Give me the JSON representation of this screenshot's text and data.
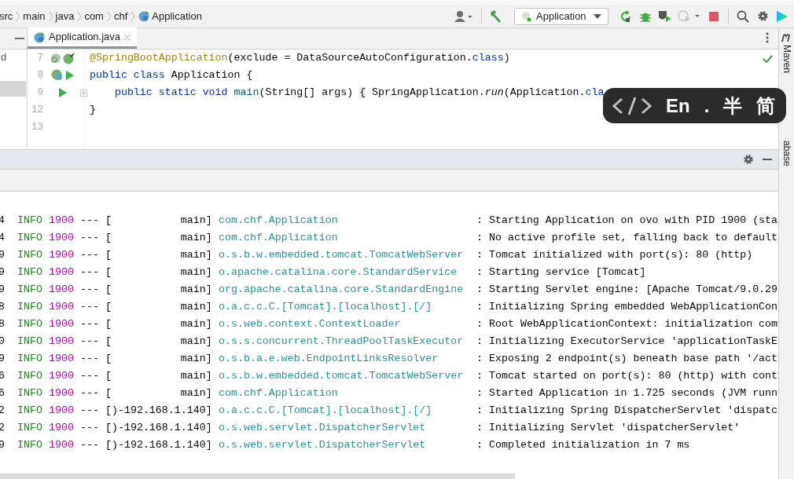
{
  "breadcrumbs": [
    "src",
    "main",
    "java",
    "com",
    "chf",
    "Application"
  ],
  "toolbar": {
    "run_config": "Application"
  },
  "project_panel": {
    "text": "d"
  },
  "editor_tabs": [
    {
      "label": "Application.java",
      "selected": true
    }
  ],
  "editor": {
    "lines": [
      {
        "number": "7",
        "gutter": [
          {
            "kind": "bean-search"
          },
          {
            "kind": "spring-check"
          }
        ],
        "fold": false,
        "tokens": [
          {
            "kind": "annotation",
            "text": "@SpringBootApplication"
          },
          {
            "kind": "plain",
            "text": "(exclude = DataSourceAutoConfiguration."
          },
          {
            "kind": "keyword",
            "text": "class"
          },
          {
            "kind": "plain",
            "text": ")"
          }
        ]
      },
      {
        "number": "8",
        "gutter": [
          {
            "kind": "spring-class"
          },
          {
            "kind": "run"
          }
        ],
        "fold": false,
        "tokens": [
          {
            "kind": "keyword",
            "text": "public class"
          },
          {
            "kind": "plain",
            "text": " Application {"
          }
        ]
      },
      {
        "number": "9",
        "gutter": [
          {
            "kind": "run"
          }
        ],
        "fold": true,
        "tokens": [
          {
            "kind": "keyword",
            "text": "    public static void"
          },
          {
            "kind": "method",
            "text": " main"
          },
          {
            "kind": "plain",
            "text": "(String[] args) "
          },
          {
            "kind": "brace",
            "text": "{"
          },
          {
            "kind": "plain",
            "text": " SpringApplication."
          },
          {
            "kind": "italic",
            "text": "run"
          },
          {
            "kind": "plain",
            "text": "(Application."
          },
          {
            "kind": "keyword",
            "text": "cla"
          }
        ]
      },
      {
        "number": "12",
        "fold": false,
        "tokens": [
          {
            "kind": "plain",
            "text": "}"
          }
        ]
      },
      {
        "number": "13",
        "fold": false
      }
    ]
  },
  "right_sidebar": [
    "Maven",
    "abase"
  ],
  "ime_overlay": {
    "items": [
      "En",
      ".",
      "半",
      "简"
    ]
  },
  "console": {
    "lines": [
      {
        "time_tail": "4",
        "level": "INFO",
        "pid": "1900",
        "separator": "---",
        "thread": "[           main]",
        "logger": "com.chf.Application",
        "colon": ":",
        "message": "Starting Application on ovo with PID 1900 (sta"
      },
      {
        "time_tail": "4",
        "level": "INFO",
        "pid": "1900",
        "separator": "---",
        "thread": "[           main]",
        "logger": "com.chf.Application",
        "colon": ":",
        "message": "No active profile set, falling back to default"
      },
      {
        "time_tail": "9",
        "level": "INFO",
        "pid": "1900",
        "separator": "---",
        "thread": "[           main]",
        "logger": "o.s.b.w.embedded.tomcat.TomcatWebServer",
        "colon": ":",
        "message": "Tomcat initialized with port(s): 80 (http)"
      },
      {
        "time_tail": "9",
        "level": "INFO",
        "pid": "1900",
        "separator": "---",
        "thread": "[           main]",
        "logger": "o.apache.catalina.core.StandardService",
        "colon": ":",
        "message": "Starting service [Tomcat]"
      },
      {
        "time_tail": "9",
        "level": "INFO",
        "pid": "1900",
        "separator": "---",
        "thread": "[           main]",
        "logger": "org.apache.catalina.core.StandardEngine",
        "colon": ":",
        "message": "Starting Servlet engine: [Apache Tomcat/9.0.29"
      },
      {
        "time_tail": "8",
        "level": "INFO",
        "pid": "1900",
        "separator": "---",
        "thread": "[           main]",
        "logger": "o.a.c.c.C.[Tomcat].[localhost].[/]",
        "colon": ":",
        "message": "Initializing Spring embedded WebApplicationCon"
      },
      {
        "time_tail": "8",
        "level": "INFO",
        "pid": "1900",
        "separator": "---",
        "thread": "[           main]",
        "logger": "o.s.web.context.ContextLoader",
        "colon": ":",
        "message": "Root WebApplicationContext: initialization com"
      },
      {
        "time_tail": "0",
        "level": "INFO",
        "pid": "1900",
        "separator": "---",
        "thread": "[           main]",
        "logger": "o.s.s.concurrent.ThreadPoolTaskExecutor",
        "colon": ":",
        "message": "Initializing ExecutorService 'applicationTaskE"
      },
      {
        "time_tail": "9",
        "level": "INFO",
        "pid": "1900",
        "separator": "---",
        "thread": "[           main]",
        "logger": "o.s.b.a.e.web.EndpointLinksResolver",
        "colon": ":",
        "message": "Exposing 2 endpoint(s) beneath base path '/act"
      },
      {
        "time_tail": "6",
        "level": "INFO",
        "pid": "1900",
        "separator": "---",
        "thread": "[           main]",
        "logger": "o.s.b.w.embedded.tomcat.TomcatWebServer",
        "colon": ":",
        "message": "Tomcat started on port(s): 80 (http) with cont"
      },
      {
        "time_tail": "6",
        "level": "INFO",
        "pid": "1900",
        "separator": "---",
        "thread": "[           main]",
        "logger": "com.chf.Application",
        "colon": ":",
        "message": "Started Application in 1.725 seconds (JVM runn"
      },
      {
        "time_tail": "2",
        "level": "INFO",
        "pid": "1900",
        "separator": "---",
        "thread": "[)-192.168.1.140]",
        "logger": "o.a.c.c.C.[Tomcat].[localhost].[/]",
        "colon": ":",
        "message": "Initializing Spring DispatcherServlet 'dispatc"
      },
      {
        "time_tail": "2",
        "level": "INFO",
        "pid": "1900",
        "separator": "---",
        "thread": "[)-192.168.1.140]",
        "logger": "o.s.web.servlet.DispatcherServlet",
        "colon": ":",
        "message": "Initializing Servlet 'dispatcherServlet'"
      },
      {
        "time_tail": "9",
        "level": "INFO",
        "pid": "1900",
        "separator": "---",
        "thread": "[)-192.168.1.140]",
        "logger": "o.s.web.servlet.DispatcherServlet",
        "colon": ":",
        "message": "Completed initialization in 7 ms"
      }
    ]
  }
}
